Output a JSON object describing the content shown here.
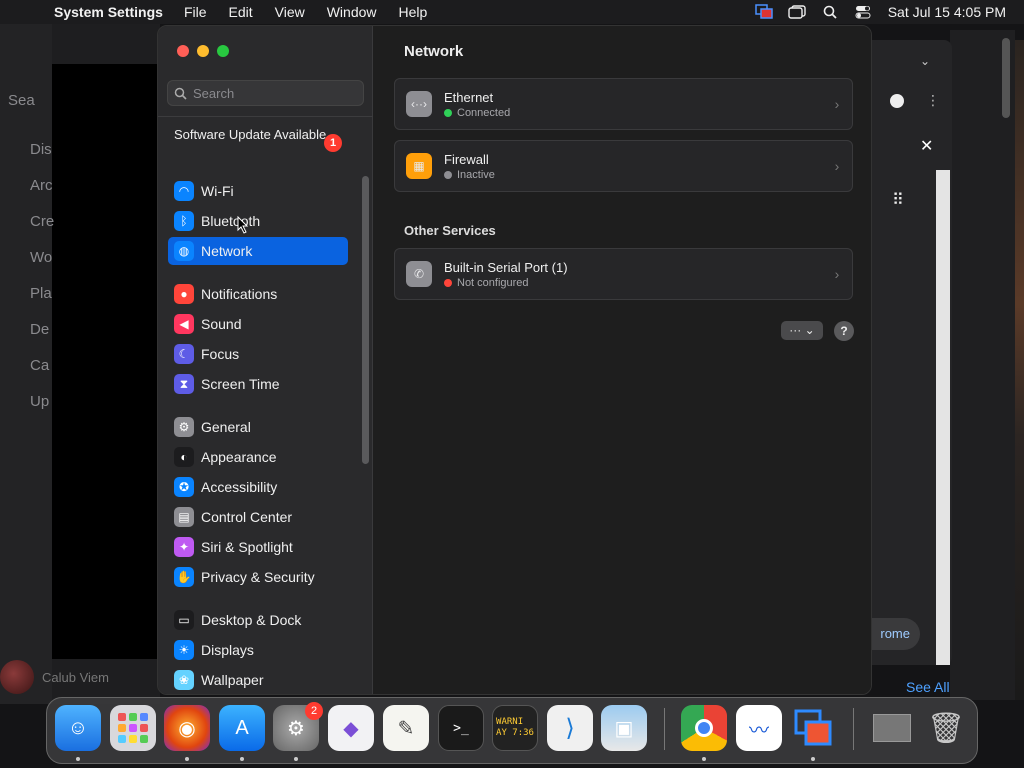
{
  "menubar": {
    "app_name": "System Settings",
    "menus": [
      "File",
      "Edit",
      "View",
      "Window",
      "Help"
    ],
    "clock": "Sat Jul 15  4:05 PM"
  },
  "background": {
    "left_items": [
      "Sea",
      "Dis",
      "Arc",
      "Cre",
      "Wo",
      "Pla",
      "De",
      "Ca",
      "Up"
    ],
    "user_name": "Calub Viem",
    "see_all": "See All",
    "right_pill": "rome"
  },
  "sidebar": {
    "search_placeholder": "Search",
    "update_text": "Software Update Available",
    "update_badge": "1",
    "items": [
      {
        "label": "Wi-Fi",
        "icon": "wifi-icon",
        "color": "#0a84ff",
        "glyph": "◠"
      },
      {
        "label": "Bluetooth",
        "icon": "bluetooth-icon",
        "color": "#0a84ff",
        "glyph": "ᛒ"
      },
      {
        "label": "Network",
        "icon": "globe-icon",
        "color": "#0a84ff",
        "glyph": "◍",
        "selected": true
      },
      {
        "label": "Notifications",
        "icon": "bell-icon",
        "color": "#ff453a",
        "glyph": "●"
      },
      {
        "label": "Sound",
        "icon": "speaker-icon",
        "color": "#ff375f",
        "glyph": "◀"
      },
      {
        "label": "Focus",
        "icon": "moon-icon",
        "color": "#5e5ce6",
        "glyph": "☾"
      },
      {
        "label": "Screen Time",
        "icon": "hourglass-icon",
        "color": "#5e5ce6",
        "glyph": "⧗"
      },
      {
        "label": "General",
        "icon": "gear-icon",
        "color": "#8e8e93",
        "glyph": "⚙"
      },
      {
        "label": "Appearance",
        "icon": "appearance-icon",
        "color": "#1c1c1e",
        "glyph": "◐"
      },
      {
        "label": "Accessibility",
        "icon": "accessibility-icon",
        "color": "#0a84ff",
        "glyph": "✪"
      },
      {
        "label": "Control Center",
        "icon": "control-center-icon",
        "color": "#8e8e93",
        "glyph": "▤"
      },
      {
        "label": "Siri & Spotlight",
        "icon": "siri-icon",
        "color": "#bf5af2",
        "glyph": "✦"
      },
      {
        "label": "Privacy & Security",
        "icon": "hand-icon",
        "color": "#0a84ff",
        "glyph": "✋"
      },
      {
        "label": "Desktop & Dock",
        "icon": "dock-icon",
        "color": "#1c1c1e",
        "glyph": "▭"
      },
      {
        "label": "Displays",
        "icon": "display-icon",
        "color": "#0a84ff",
        "glyph": "☀"
      },
      {
        "label": "Wallpaper",
        "icon": "wallpaper-icon",
        "color": "#64d2ff",
        "glyph": "❀"
      }
    ]
  },
  "content": {
    "title": "Network",
    "services": [
      {
        "name": "Ethernet",
        "status": "Connected",
        "status_color": "#30d158",
        "icon": "ethernet-icon",
        "icon_color": "#8e8e93",
        "glyph": "‹··›"
      },
      {
        "name": "Firewall",
        "status": "Inactive",
        "status_color": "#8e8e93",
        "icon": "firewall-icon",
        "icon_color": "#ff9f0a",
        "glyph": "▦"
      }
    ],
    "other_title": "Other Services",
    "other_services": [
      {
        "name": "Built-in Serial Port (1)",
        "status": "Not configured",
        "status_color": "#ff453a",
        "icon": "phone-icon",
        "icon_color": "#8e8e93",
        "glyph": "✆"
      }
    ],
    "more_label": "··· ⌄",
    "help_label": "?"
  },
  "dock": {
    "settings_badge": "2",
    "warning_label": "WARNI\nAY 7:36"
  }
}
